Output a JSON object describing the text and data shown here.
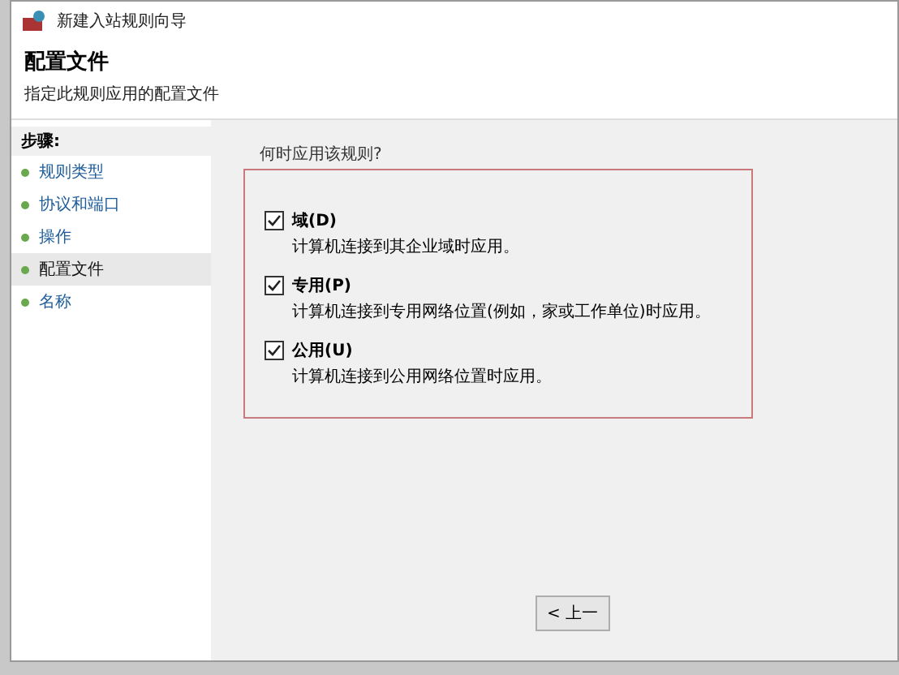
{
  "window": {
    "title": "新建入站规则向导"
  },
  "header": {
    "title": "配置文件",
    "subtitle": "指定此规则应用的配置文件"
  },
  "steps": {
    "heading": "步骤:",
    "items": [
      {
        "label": "规则类型",
        "selected": false
      },
      {
        "label": "协议和端口",
        "selected": false
      },
      {
        "label": "操作",
        "selected": false
      },
      {
        "label": "配置文件",
        "selected": true
      },
      {
        "label": "名称",
        "selected": false
      }
    ]
  },
  "question": "何时应用该规则?",
  "options": [
    {
      "label": "域(D)",
      "description": "计算机连接到其企业域时应用。",
      "checked": true
    },
    {
      "label": "专用(P)",
      "description": "计算机连接到专用网络位置(例如，家或工作单位)时应用。",
      "checked": true
    },
    {
      "label": "公用(U)",
      "description": "计算机连接到公用网络位置时应用。",
      "checked": true
    }
  ],
  "buttons": [
    {
      "label": "< 上一"
    }
  ]
}
